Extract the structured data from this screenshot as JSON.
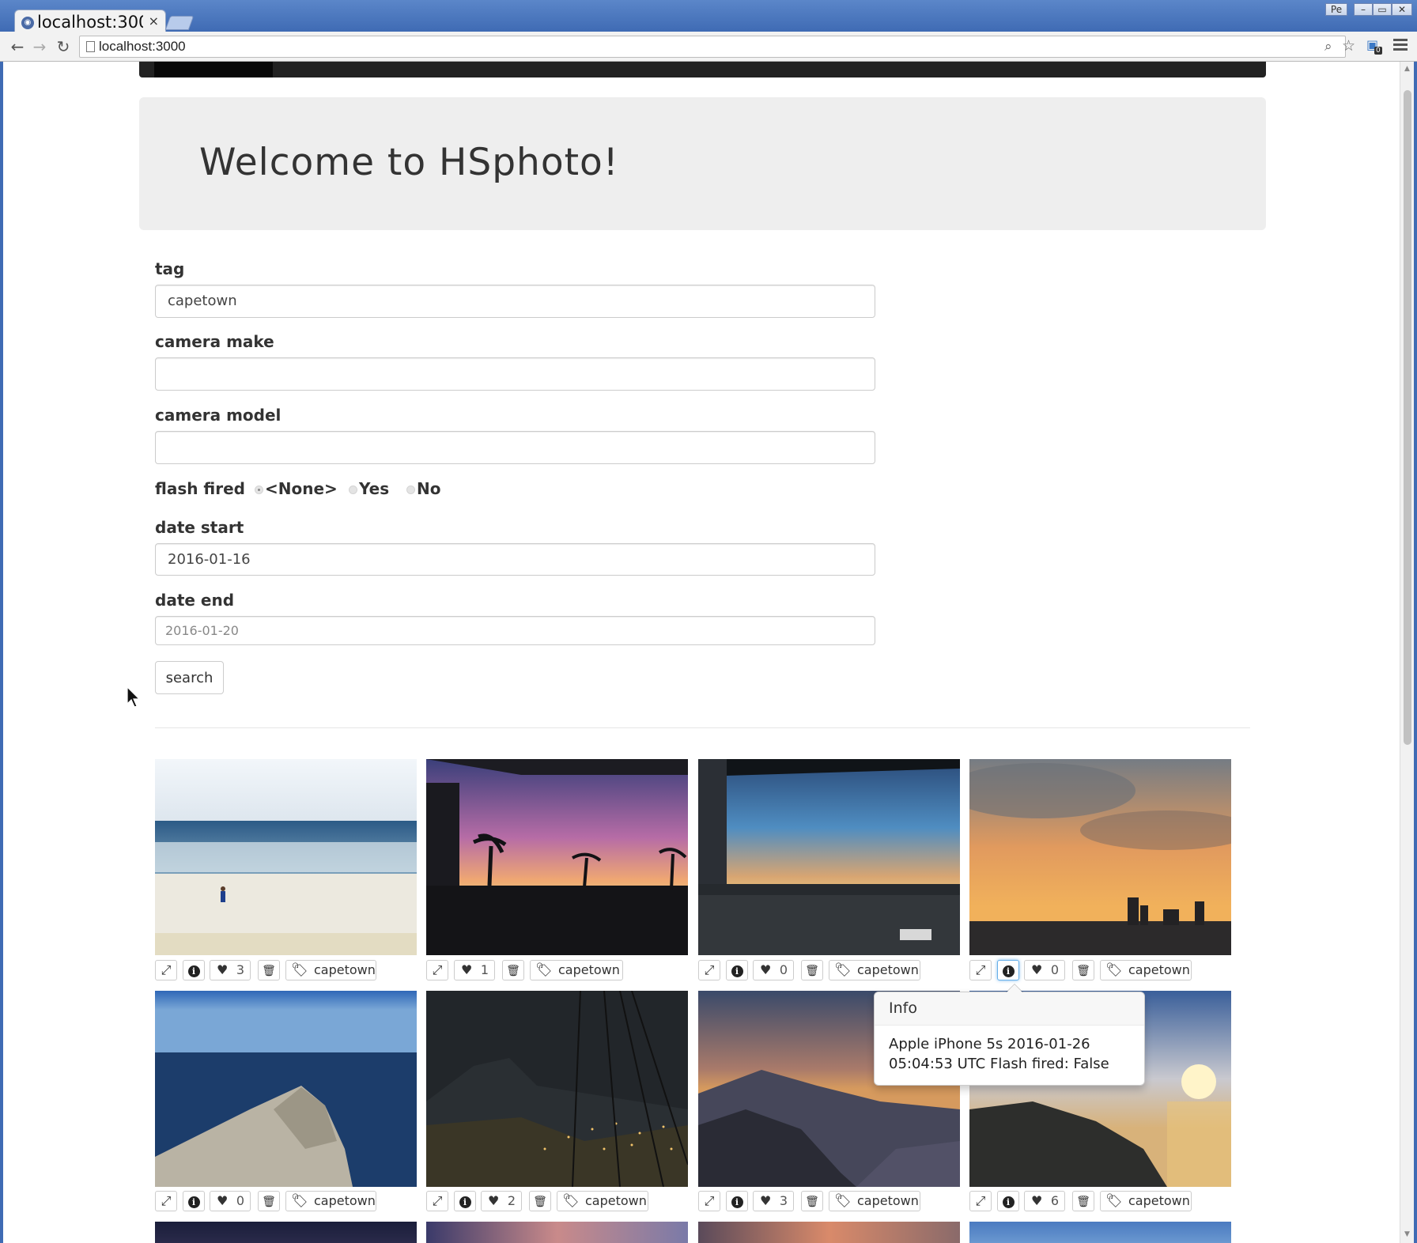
{
  "browser": {
    "tab_title": "localhost:3000",
    "tab_close": "×",
    "url": "localhost:3000",
    "ext_badge": "0",
    "profile_label": "Pe"
  },
  "page": {
    "heading": "Welcome to HSphoto!",
    "form": {
      "tag_label": "tag",
      "tag_value": "capetown",
      "make_label": "camera make",
      "make_value": "",
      "model_label": "camera model",
      "model_value": "",
      "flash_label": "flash fired",
      "flash_options": [
        "<None>",
        "Yes",
        "No"
      ],
      "flash_selected": "<None>",
      "date_start_label": "date start",
      "date_start_value": "2016-01-16",
      "date_end_label": "date end",
      "date_end_placeholder": "2016-01-20",
      "search_label": "search"
    },
    "photos": [
      {
        "likes": "3",
        "tag": "capetown",
        "scene": "beach"
      },
      {
        "likes": "1",
        "tag": "capetown",
        "scene": "palm-sunset"
      },
      {
        "likes": "0",
        "tag": "capetown",
        "scene": "airport-sunrise"
      },
      {
        "likes": "0",
        "tag": "capetown",
        "scene": "city-sunset"
      },
      {
        "likes": "0",
        "tag": "capetown",
        "scene": "cliff-ocean"
      },
      {
        "likes": "2",
        "tag": "capetown",
        "scene": "night-city"
      },
      {
        "likes": "3",
        "tag": "capetown",
        "scene": "mountain-sunset"
      },
      {
        "likes": "6",
        "tag": "capetown",
        "scene": "sea-sun"
      }
    ],
    "popover": {
      "title": "Info",
      "line1": "Apple iPhone 5s 2016-01-26",
      "line2": "05:04:53 UTC Flash fired: False"
    }
  }
}
